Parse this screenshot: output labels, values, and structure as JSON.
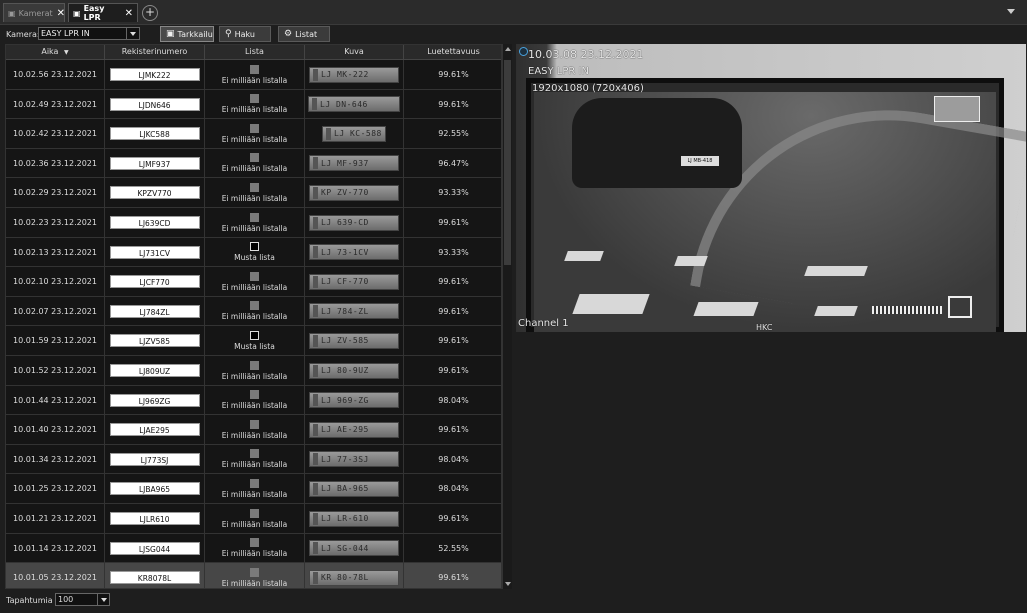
{
  "tabs": [
    {
      "label": "Kamerat",
      "icon": "camera-icon",
      "active": false
    },
    {
      "label": "Easy LPR",
      "icon": "camera-icon",
      "active": true
    }
  ],
  "toolbar": {
    "camera_label": "Kamera:",
    "camera_value": "EASY LPR IN",
    "buttons": [
      {
        "label": "Tarkkailu",
        "icon": "camera-icon"
      },
      {
        "label": "Haku",
        "icon": "search-icon"
      },
      {
        "label": "Listat",
        "icon": "gear-icon"
      }
    ]
  },
  "table": {
    "columns": [
      "Aika",
      "Rekisterinumero",
      "Lista",
      "Kuva",
      "Luetettavuus"
    ],
    "rows": [
      {
        "time": "10.02.56 23.12.2021",
        "plate": "LJMK222",
        "list": "Ei milliään listalla",
        "black": false,
        "img": "LJ MK-222",
        "conf": "99.61%"
      },
      {
        "time": "10.02.49 23.12.2021",
        "plate": "LJDN646",
        "list": "Ei milliään listalla",
        "black": false,
        "img": "LJ DN-646",
        "conf": "99.61%"
      },
      {
        "time": "10.02.42 23.12.2021",
        "plate": "LJKC588",
        "list": "Ei milliään listalla",
        "black": false,
        "img": "LJ KC-588",
        "conf": "92.55%"
      },
      {
        "time": "10.02.36 23.12.2021",
        "plate": "LJMF937",
        "list": "Ei milliään listalla",
        "black": false,
        "img": "LJ MF-937",
        "conf": "96.47%"
      },
      {
        "time": "10.02.29 23.12.2021",
        "plate": "KPZV770",
        "list": "Ei milliään listalla",
        "black": false,
        "img": "KP ZV-770",
        "conf": "93.33%"
      },
      {
        "time": "10.02.23 23.12.2021",
        "plate": "LJ639CD",
        "list": "Ei milliään listalla",
        "black": false,
        "img": "LJ 639-CD",
        "conf": "99.61%"
      },
      {
        "time": "10.02.13 23.12.2021",
        "plate": "LJ731CV",
        "list": "Musta lista",
        "black": true,
        "img": "LJ 73-1CV",
        "conf": "93.33%"
      },
      {
        "time": "10.02.10 23.12.2021",
        "plate": "LJCF770",
        "list": "Ei milliään listalla",
        "black": false,
        "img": "LJ CF-770",
        "conf": "99.61%"
      },
      {
        "time": "10.02.07 23.12.2021",
        "plate": "LJ784ZL",
        "list": "Ei milliään listalla",
        "black": false,
        "img": "LJ 784-ZL",
        "conf": "99.61%"
      },
      {
        "time": "10.01.59 23.12.2021",
        "plate": "LJZV585",
        "list": "Musta lista",
        "black": true,
        "img": "LJ ZV-585",
        "conf": "99.61%"
      },
      {
        "time": "10.01.52 23.12.2021",
        "plate": "LJ809UZ",
        "list": "Ei milliään listalla",
        "black": false,
        "img": "LJ 80-9UZ",
        "conf": "99.61%"
      },
      {
        "time": "10.01.44 23.12.2021",
        "plate": "LJ969ZG",
        "list": "Ei milliään listalla",
        "black": false,
        "img": "LJ 969-ZG",
        "conf": "98.04%"
      },
      {
        "time": "10.01.40 23.12.2021",
        "plate": "LJAE295",
        "list": "Ei milliään listalla",
        "black": false,
        "img": "LJ AE-295",
        "conf": "99.61%"
      },
      {
        "time": "10.01.34 23.12.2021",
        "plate": "LJ773SJ",
        "list": "Ei milliään listalla",
        "black": false,
        "img": "LJ 77-3SJ",
        "conf": "98.04%"
      },
      {
        "time": "10.01.25 23.12.2021",
        "plate": "LJBA965",
        "list": "Ei milliään listalla",
        "black": false,
        "img": "LJ BA-965",
        "conf": "98.04%"
      },
      {
        "time": "10.01.21 23.12.2021",
        "plate": "LJLR610",
        "list": "Ei milliään listalla",
        "black": false,
        "img": "LJ LR-610",
        "conf": "99.61%"
      },
      {
        "time": "10.01.14 23.12.2021",
        "plate": "LJSG044",
        "list": "Ei milliään listalla",
        "black": false,
        "img": "LJ SG-044",
        "conf": "52.55%"
      },
      {
        "time": "10.01.05 23.12.2021",
        "plate": "KR8078L",
        "list": "Ei milliään listalla",
        "black": false,
        "img": "KR 80-78L",
        "conf": "99.61%"
      }
    ]
  },
  "footer": {
    "label": "Tapahtumia",
    "value": "100"
  },
  "video": {
    "timestamp": "10.03.08  23.12.2021",
    "camera_name": "EASY LPR IN",
    "resolution": "1920x1080 (720x406)",
    "channel": "Channel 1",
    "brand": "HKC",
    "car_plate": "LJ MB-418"
  }
}
